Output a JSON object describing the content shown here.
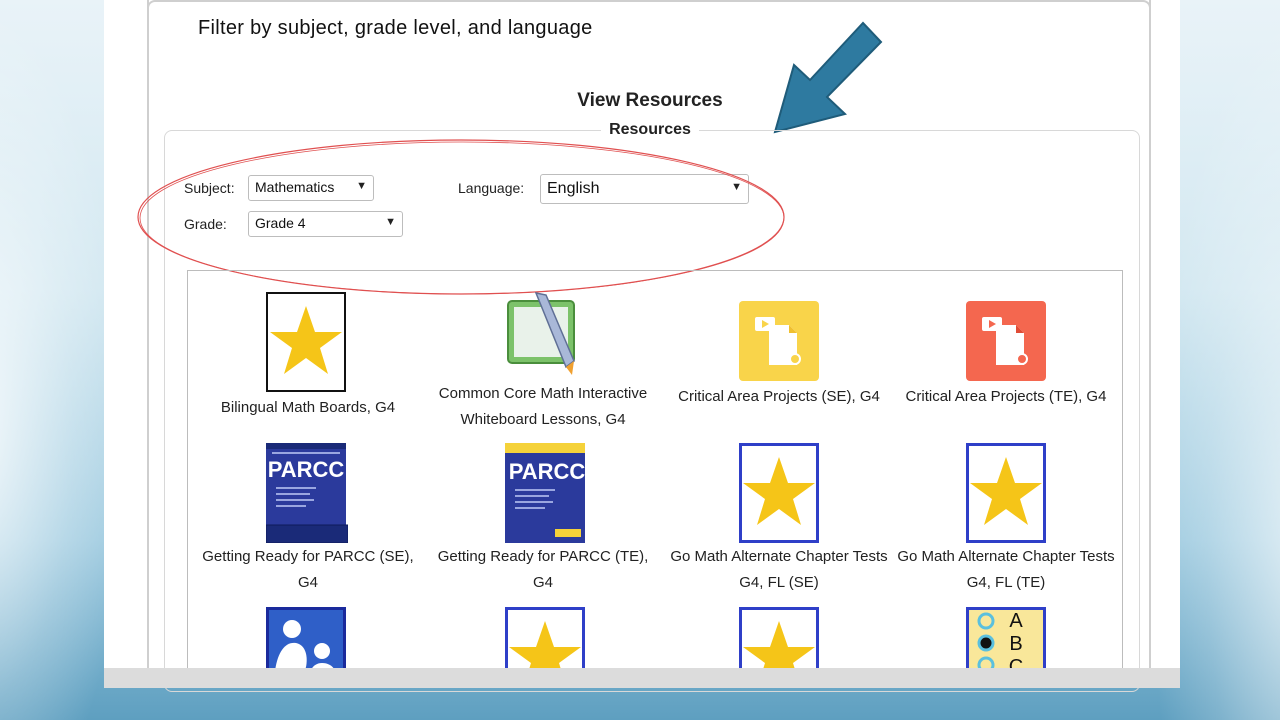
{
  "caption": "Filter by subject, grade level, and language",
  "page_title": "View Resources",
  "section_legend": "Resources",
  "filters": {
    "subject_label": "Subject:",
    "subject_value": "Mathematics",
    "grade_label": "Grade:",
    "grade_value": "Grade 4",
    "language_label": "Language:",
    "language_value": "English"
  },
  "resources": [
    {
      "title": "Bilingual Math Boards, G4",
      "icon": "star-icon"
    },
    {
      "title": "Common Core Math Interactive Whiteboard Lessons, G4",
      "icon": "whiteboard-icon"
    },
    {
      "title": "Critical Area Projects (SE), G4",
      "icon": "media-file-icon"
    },
    {
      "title": "Critical Area Projects (TE), G4",
      "icon": "media-file-icon"
    },
    {
      "title": "Getting Ready for PARCC (SE), G4",
      "icon": "book-cover-icon",
      "cover_text": "PARCC"
    },
    {
      "title": "Getting Ready for PARCC (TE), G4",
      "icon": "book-cover-icon",
      "cover_text": "PARCC"
    },
    {
      "title": "Go Math Alternate Chapter Tests G4, FL (SE)",
      "icon": "star-icon"
    },
    {
      "title": "Go Math Alternate Chapter Tests G4, FL (TE)",
      "icon": "star-icon"
    },
    {
      "title": "",
      "icon": "family-icon"
    },
    {
      "title": "",
      "icon": "star-icon"
    },
    {
      "title": "",
      "icon": "star-icon"
    },
    {
      "title": "",
      "icon": "answer-sheet-icon",
      "letters": [
        "A",
        "B",
        "C"
      ]
    }
  ],
  "colors": {
    "arrow": "#2e7aa0",
    "ellipse": "#e05050",
    "star": "#f5c518",
    "media_yellow": "#f9d44a",
    "media_red": "#f4674f",
    "book_blue": "#2b3a9c"
  }
}
